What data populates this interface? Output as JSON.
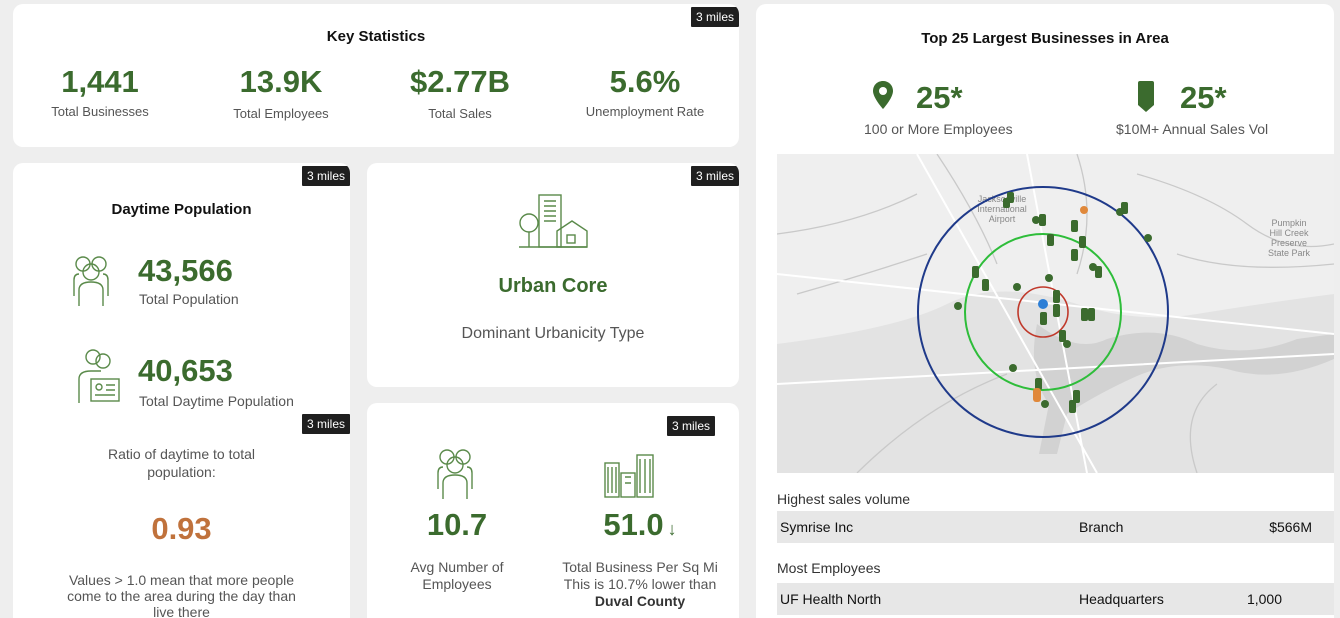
{
  "colors": {
    "accent_green": "#3b6b2e",
    "ratio_orange": "#c0723c",
    "badge_bg": "#1f1f1f"
  },
  "key_stats": {
    "badge": "3 miles",
    "title": "Key Statistics",
    "items": [
      {
        "value": "1,441",
        "label": "Total Businesses"
      },
      {
        "value": "13.9K",
        "label": "Total Employees"
      },
      {
        "value": "$2.77B",
        "label": "Total Sales"
      },
      {
        "value": "5.6%",
        "label": "Unemployment Rate"
      }
    ]
  },
  "daytime": {
    "badge": "3 miles",
    "title": "Daytime Population",
    "total_value": "43,566",
    "total_label": "Total Population",
    "daytime_value": "40,653",
    "daytime_label": "Total Daytime Population",
    "icon_people": "people-group-icon",
    "icon_badge": "person-id-icon"
  },
  "ratio": {
    "badge": "3 miles",
    "label_line1": "Ratio of daytime to total",
    "label_line2": "population:",
    "value": "0.93",
    "note_line1": "Values > 1.0 mean that more people",
    "note_line2": "come to the area during the day than",
    "note_line3": "live there"
  },
  "urbanicity": {
    "badge": "3 miles",
    "value": "Urban Core",
    "label": "Dominant Urbanicity Type",
    "icon": "city-buildings-icon"
  },
  "business_density": {
    "badge": "3 miles",
    "avg_value": "10.7",
    "avg_label_line1": "Avg Number of",
    "avg_label_line2": "Employees",
    "density_value": "51.0",
    "arrow": "↓",
    "density_label": "Total Business Per Sq Mi",
    "compare_text": "This is 10.7% lower than",
    "compare_area": "Duval County"
  },
  "top_businesses": {
    "title": "Top 25 Largest Businesses in Area",
    "employees_value": "25*",
    "employees_label": "100 or More Employees",
    "sales_value": "25*",
    "sales_label": "$10M+ Annual Sales Vol",
    "map": {
      "airport_label_1": "Jacksonville",
      "airport_label_2": "International",
      "airport_label_3": "Airport",
      "park_label_1": "Pumpkin",
      "park_label_2": "Hill Creek",
      "park_label_3": "Preserve",
      "park_label_4": "State Park"
    },
    "highest_sales_heading": "Highest sales volume",
    "highest_sales_row": {
      "name": "Symrise Inc",
      "type": "Branch",
      "value": "$566M"
    },
    "most_employees_heading": "Most Employees",
    "most_employees_row": {
      "name": "UF Health North",
      "type": "Headquarters",
      "value": "1,000"
    }
  }
}
